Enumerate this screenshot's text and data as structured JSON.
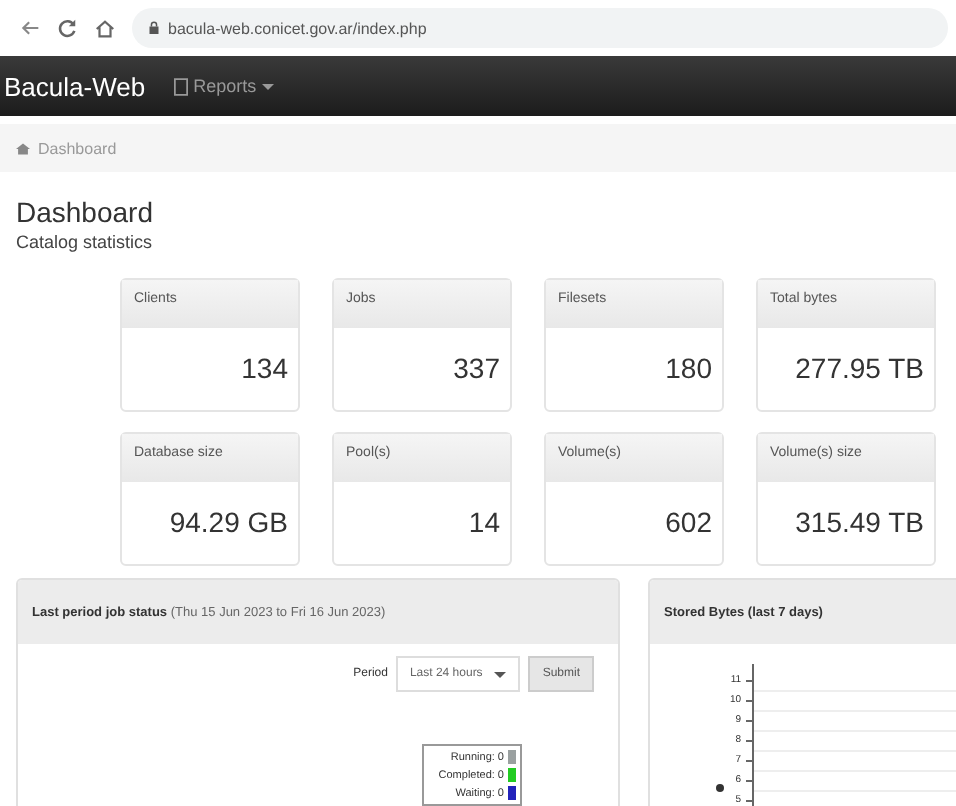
{
  "browser": {
    "url": "bacula-web.conicet.gov.ar/index.php"
  },
  "navbar": {
    "brand": "Bacula-Web",
    "menu": "Reports"
  },
  "breadcrumb": "Dashboard",
  "page": {
    "title": "Dashboard",
    "subtitle": "Catalog statistics"
  },
  "stats": [
    {
      "label": "Clients",
      "value": "134"
    },
    {
      "label": "Jobs",
      "value": "337"
    },
    {
      "label": "Filesets",
      "value": "180"
    },
    {
      "label": "Total bytes",
      "value": "277.95 TB"
    },
    {
      "label": "Database size",
      "value": "94.29 GB"
    },
    {
      "label": "Pool(s)",
      "value": "14"
    },
    {
      "label": "Volume(s)",
      "value": "602"
    },
    {
      "label": "Volume(s) size",
      "value": "315.49 TB"
    }
  ],
  "job_status_panel": {
    "title": "Last period job status",
    "range": "(Thu 15 Jun 2023 to Fri 16 Jun 2023)",
    "period_label": "Period",
    "period_value": "Last 24 hours",
    "submit": "Submit",
    "legend": [
      {
        "label": "Running: 0",
        "color": "#9aa0a0"
      },
      {
        "label": "Completed: 0",
        "color": "#22cc22"
      },
      {
        "label": "Waiting: 0",
        "color": "#2222bb"
      }
    ]
  },
  "stored_bytes_panel": {
    "title": "Stored Bytes (last 7 days)",
    "y_ticks": [
      "11",
      "10",
      "9",
      "8",
      "7",
      "6",
      "5"
    ]
  }
}
